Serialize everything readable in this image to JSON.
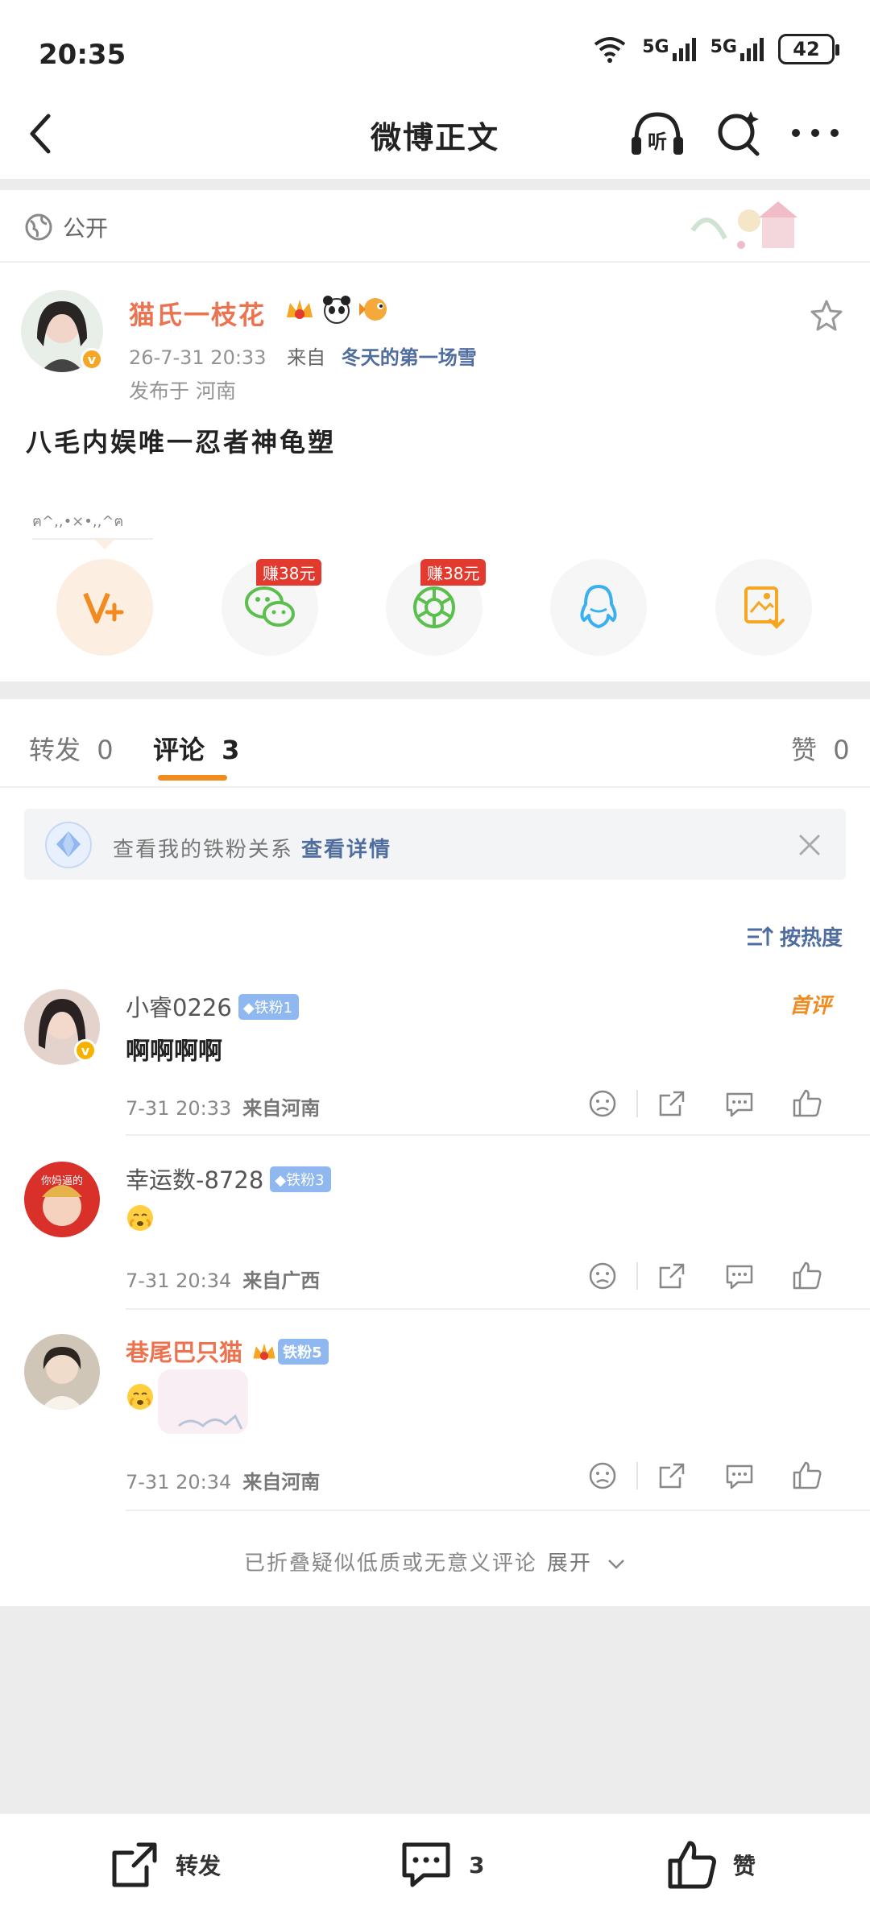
{
  "status_bar": {
    "time": "20:35",
    "network_1": "5G",
    "network_2": "5G",
    "battery": "42"
  },
  "nav": {
    "title": "微博正文",
    "listen_label": "听"
  },
  "visibility": {
    "label": "公开"
  },
  "post": {
    "author": "猫氏一枝花",
    "date": "26-7-31 20:33",
    "from_label": "来自",
    "source": "冬天的第一场雪",
    "location": "发布于 河南",
    "text": "八毛内娱唯一忍者神龟塑",
    "kaomoji": "ฅ^,,•×•,,^ฅ"
  },
  "share": {
    "earn_wechat": "赚38元",
    "earn_moments": "赚38元",
    "icons": [
      "vplus-icon",
      "wechat-icon",
      "moments-icon",
      "qq-icon",
      "save-image-icon"
    ]
  },
  "tabs": {
    "repost_label": "转发",
    "repost_count": "0",
    "comment_label": "评论",
    "comment_count": "3",
    "like_label": "赞",
    "like_count": "0"
  },
  "fan_banner": {
    "text": "查看我的铁粉关系",
    "link": "查看详情"
  },
  "sort": {
    "label": "按热度"
  },
  "comments": [
    {
      "name": "小睿0226",
      "badge": "铁粉1",
      "text": "啊啊啊啊",
      "time": "7-31 20:33",
      "location": "来自河南",
      "tag": "首评"
    },
    {
      "name": "幸运数-8728",
      "badge": "铁粉3",
      "time": "7-31 20:34",
      "location": "来自广西",
      "avatar_text": "你妈逼的"
    },
    {
      "name": "巷尾巴只猫",
      "badge": "铁粉5",
      "time": "7-31 20:34",
      "location": "来自河南"
    }
  ],
  "folded": {
    "text": "已折叠疑似低质或无意义评论",
    "expand": "展开"
  },
  "bottom_bar": {
    "repost": "转发",
    "comment_count": "3",
    "like": "赞"
  },
  "colors": {
    "accent": "#eb7350",
    "link": "#4f6d9e",
    "tab_underline": "#f28b1f",
    "earn_badge": "#e33a2f"
  }
}
